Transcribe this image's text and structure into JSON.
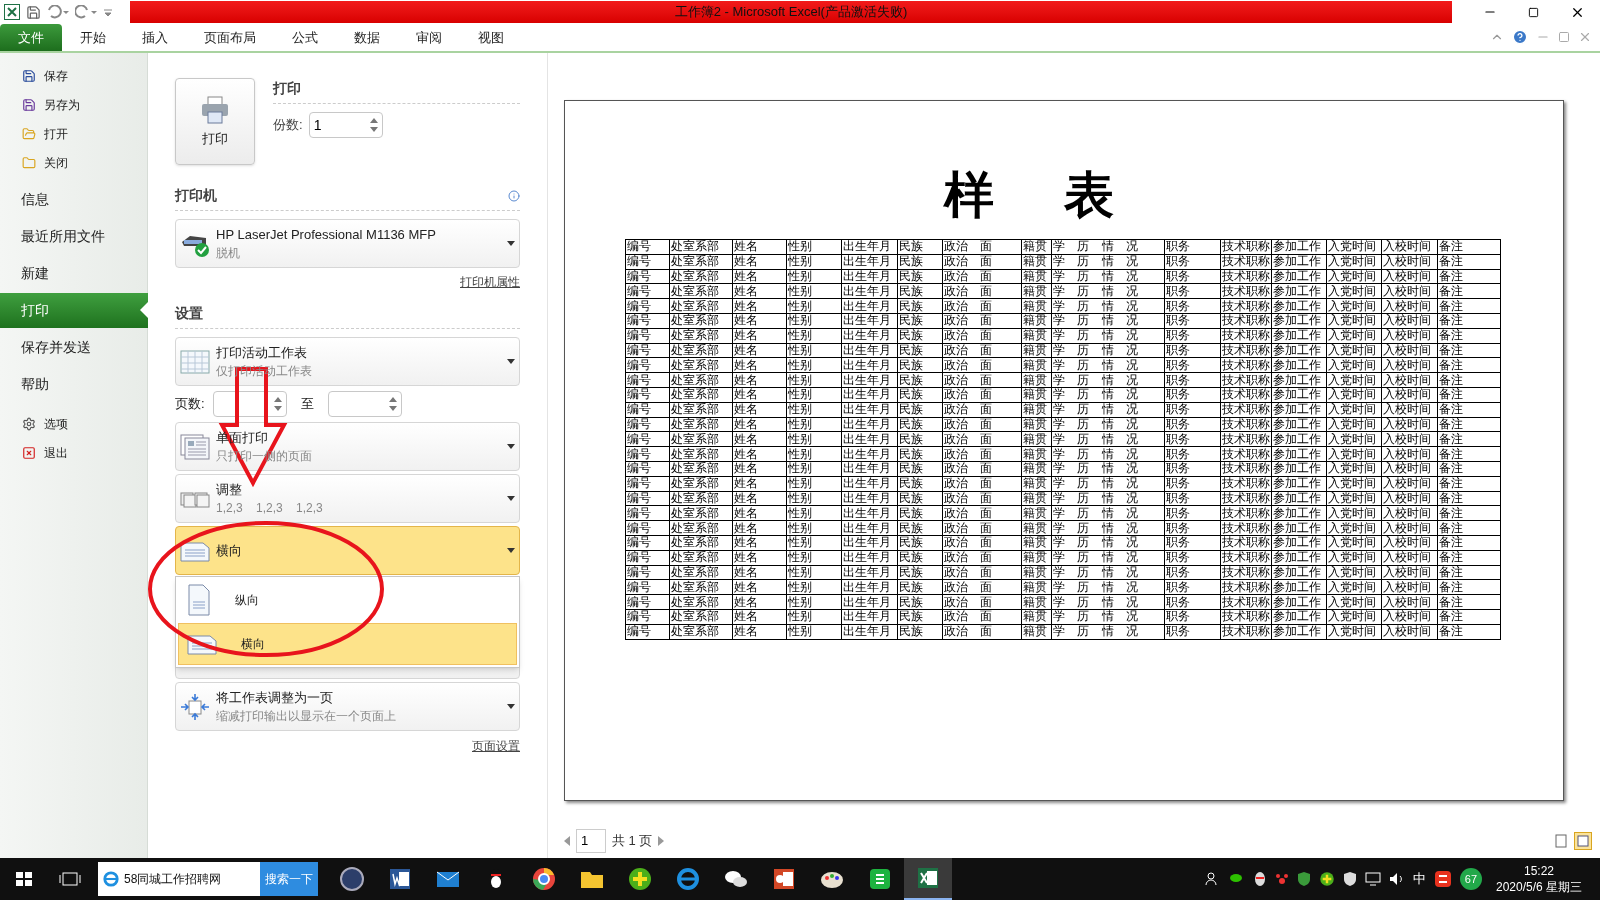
{
  "window": {
    "title": "工作簿2 - Microsoft Excel(产品激活失败)"
  },
  "ribbon_tabs": [
    {
      "label": "文件",
      "selected": true
    },
    {
      "label": "开始",
      "selected": false
    },
    {
      "label": "插入",
      "selected": false
    },
    {
      "label": "页面布局",
      "selected": false
    },
    {
      "label": "公式",
      "selected": false
    },
    {
      "label": "数据",
      "selected": false
    },
    {
      "label": "审阅",
      "selected": false
    },
    {
      "label": "视图",
      "selected": false
    }
  ],
  "backstage_nav": [
    {
      "label": "保存",
      "kind": "command",
      "selected": false
    },
    {
      "label": "另存为",
      "kind": "command",
      "selected": false
    },
    {
      "label": "打开",
      "kind": "command",
      "selected": false
    },
    {
      "label": "关闭",
      "kind": "command",
      "selected": false
    },
    {
      "label": "信息",
      "kind": "section",
      "selected": false
    },
    {
      "label": "最近所用文件",
      "kind": "section",
      "selected": false
    },
    {
      "label": "新建",
      "kind": "section",
      "selected": false
    },
    {
      "label": "打印",
      "kind": "section",
      "selected": true
    },
    {
      "label": "保存并发送",
      "kind": "section",
      "selected": false
    },
    {
      "label": "帮助",
      "kind": "section",
      "selected": false
    },
    {
      "label": "选项",
      "kind": "command",
      "selected": false
    },
    {
      "label": "退出",
      "kind": "command",
      "selected": false
    }
  ],
  "print": {
    "heading": "打印",
    "button": "打印",
    "copies_label": "份数:",
    "copies": "1"
  },
  "printer": {
    "heading": "打印机",
    "name": "HP LaserJet Professional M1136 MFP",
    "status": "脱机",
    "properties_link": "打印机属性"
  },
  "settings": {
    "heading": "设置",
    "page_setup_link": "页面设置",
    "items": [
      {
        "kind": "sheets",
        "title": "打印活动工作表",
        "subtitle": "仅打印活动工作表"
      },
      {
        "kind": "pages",
        "label": "页数:",
        "to": "至"
      },
      {
        "kind": "sides",
        "title": "单面打印",
        "subtitle": "只打印一侧的页面"
      },
      {
        "kind": "collate",
        "title": "调整",
        "subtitle": "1,2,3    1,2,3    1,2,3"
      },
      {
        "kind": "orientation",
        "title": "横向",
        "expanded": true,
        "options": [
          {
            "label": "纵向",
            "kind": "portrait",
            "selected": false
          },
          {
            "label": "横向",
            "kind": "landscape",
            "selected": true
          }
        ]
      },
      {
        "kind": "blank"
      },
      {
        "kind": "scaling",
        "title": "将工作表调整为一页",
        "subtitle": "缩减打印输出以显示在一个页面上"
      }
    ]
  },
  "preview": {
    "sheet_title": "样    表",
    "rows": [
      [
        "编号",
        "处室系部",
        "姓名",
        "性别",
        "出生年月",
        "民族",
        "政治 面",
        "籍贯",
        "学 历 情 况",
        "职务",
        "技术职称",
        "参加工作",
        "入党时间",
        "入校时间",
        "备注"
      ],
      [
        "编号",
        "处室系部",
        "姓名",
        "性别",
        "出生年月",
        "民族",
        "政治 面",
        "籍贯",
        "学 历 情 况",
        "职务",
        "技术职称",
        "参加工作",
        "入党时间",
        "入校时间",
        "备注"
      ],
      [
        "编号",
        "处室系部",
        "姓名",
        "性别",
        "出生年月",
        "民族",
        "政治 面",
        "籍贯",
        "学 历 情 况",
        "职务",
        "技术职称",
        "参加工作",
        "入党时间",
        "入校时间",
        "备注"
      ],
      [
        "编号",
        "处室系部",
        "姓名",
        "性别",
        "出生年月",
        "民族",
        "政治 面",
        "籍贯",
        "学 历 情 况",
        "职务",
        "技术职称",
        "参加工作",
        "入党时间",
        "入校时间",
        "备注"
      ],
      [
        "编号",
        "处室系部",
        "姓名",
        "性别",
        "出生年月",
        "民族",
        "政治 面",
        "籍贯",
        "学 历 情 况",
        "职务",
        "技术职称",
        "参加工作",
        "入党时间",
        "入校时间",
        "备注"
      ],
      [
        "编号",
        "处室系部",
        "姓名",
        "性别",
        "出生年月",
        "民族",
        "政治 面",
        "籍贯",
        "学 历 情 况",
        "职务",
        "技术职称",
        "参加工作",
        "入党时间",
        "入校时间",
        "备注"
      ],
      [
        "编号",
        "处室系部",
        "姓名",
        "性别",
        "出生年月",
        "民族",
        "政治 面",
        "籍贯",
        "学 历 情 况",
        "职务",
        "技术职称",
        "参加工作",
        "入党时间",
        "入校时间",
        "备注"
      ],
      [
        "编号",
        "处室系部",
        "姓名",
        "性别",
        "出生年月",
        "民族",
        "政治 面",
        "籍贯",
        "学 历 情 况",
        "职务",
        "技术职称",
        "参加工作",
        "入党时间",
        "入校时间",
        "备注"
      ],
      [
        "编号",
        "处室系部",
        "姓名",
        "性别",
        "出生年月",
        "民族",
        "政治 面",
        "籍贯",
        "学 历 情 况",
        "职务",
        "技术职称",
        "参加工作",
        "入党时间",
        "入校时间",
        "备注"
      ],
      [
        "编号",
        "处室系部",
        "姓名",
        "性别",
        "出生年月",
        "民族",
        "政治 面",
        "籍贯",
        "学 历 情 况",
        "职务",
        "技术职称",
        "参加工作",
        "入党时间",
        "入校时间",
        "备注"
      ],
      [
        "编号",
        "处室系部",
        "姓名",
        "性别",
        "出生年月",
        "民族",
        "政治 面",
        "籍贯",
        "学 历 情 况",
        "职务",
        "技术职称",
        "参加工作",
        "入党时间",
        "入校时间",
        "备注"
      ],
      [
        "编号",
        "处室系部",
        "姓名",
        "性别",
        "出生年月",
        "民族",
        "政治 面",
        "籍贯",
        "学 历 情 况",
        "职务",
        "技术职称",
        "参加工作",
        "入党时间",
        "入校时间",
        "备注"
      ],
      [
        "编号",
        "处室系部",
        "姓名",
        "性别",
        "出生年月",
        "民族",
        "政治 面",
        "籍贯",
        "学 历 情 况",
        "职务",
        "技术职称",
        "参加工作",
        "入党时间",
        "入校时间",
        "备注"
      ],
      [
        "编号",
        "处室系部",
        "姓名",
        "性别",
        "出生年月",
        "民族",
        "政治 面",
        "籍贯",
        "学 历 情 况",
        "职务",
        "技术职称",
        "参加工作",
        "入党时间",
        "入校时间",
        "备注"
      ],
      [
        "编号",
        "处室系部",
        "姓名",
        "性别",
        "出生年月",
        "民族",
        "政治 面",
        "籍贯",
        "学 历 情 况",
        "职务",
        "技术职称",
        "参加工作",
        "入党时间",
        "入校时间",
        "备注"
      ],
      [
        "编号",
        "处室系部",
        "姓名",
        "性别",
        "出生年月",
        "民族",
        "政治 面",
        "籍贯",
        "学 历 情 况",
        "职务",
        "技术职称",
        "参加工作",
        "入党时间",
        "入校时间",
        "备注"
      ],
      [
        "编号",
        "处室系部",
        "姓名",
        "性别",
        "出生年月",
        "民族",
        "政治 面",
        "籍贯",
        "学 历 情 况",
        "职务",
        "技术职称",
        "参加工作",
        "入党时间",
        "入校时间",
        "备注"
      ],
      [
        "编号",
        "处室系部",
        "姓名",
        "性别",
        "出生年月",
        "民族",
        "政治 面",
        "籍贯",
        "学 历 情 况",
        "职务",
        "技术职称",
        "参加工作",
        "入党时间",
        "入校时间",
        "备注"
      ],
      [
        "编号",
        "处室系部",
        "姓名",
        "性别",
        "出生年月",
        "民族",
        "政治 面",
        "籍贯",
        "学 历 情 况",
        "职务",
        "技术职称",
        "参加工作",
        "入党时间",
        "入校时间",
        "备注"
      ],
      [
        "编号",
        "处室系部",
        "姓名",
        "性别",
        "出生年月",
        "民族",
        "政治 面",
        "籍贯",
        "学 历 情 况",
        "职务",
        "技术职称",
        "参加工作",
        "入党时间",
        "入校时间",
        "备注"
      ],
      [
        "编号",
        "处室系部",
        "姓名",
        "性别",
        "出生年月",
        "民族",
        "政治 面",
        "籍贯",
        "学 历 情 况",
        "职务",
        "技术职称",
        "参加工作",
        "入党时间",
        "入校时间",
        "备注"
      ],
      [
        "编号",
        "处室系部",
        "姓名",
        "性别",
        "出生年月",
        "民族",
        "政治 面",
        "籍贯",
        "学 历 情 况",
        "职务",
        "技术职称",
        "参加工作",
        "入党时间",
        "入校时间",
        "备注"
      ],
      [
        "编号",
        "处室系部",
        "姓名",
        "性别",
        "出生年月",
        "民族",
        "政治 面",
        "籍贯",
        "学 历 情 况",
        "职务",
        "技术职称",
        "参加工作",
        "入党时间",
        "入校时间",
        "备注"
      ],
      [
        "编号",
        "处室系部",
        "姓名",
        "性别",
        "出生年月",
        "民族",
        "政治 面",
        "籍贯",
        "学 历 情 况",
        "职务",
        "技术职称",
        "参加工作",
        "入党时间",
        "入校时间",
        "备注"
      ],
      [
        "编号",
        "处室系部",
        "姓名",
        "性别",
        "出生年月",
        "民族",
        "政治 面",
        "籍贯",
        "学 历 情 况",
        "职务",
        "技术职称",
        "参加工作",
        "入党时间",
        "入校时间",
        "备注"
      ],
      [
        "编号",
        "处室系部",
        "姓名",
        "性别",
        "出生年月",
        "民族",
        "政治 面",
        "籍贯",
        "学 历 情 况",
        "职务",
        "技术职称",
        "参加工作",
        "入党时间",
        "入校时间",
        "备注"
      ],
      [
        "编号",
        "处室系部",
        "姓名",
        "性别",
        "出生年月",
        "民族",
        "政治 面",
        "籍贯",
        "学 历 情 况",
        "职务",
        "技术职称",
        "参加工作",
        "入党时间",
        "入校时间",
        "备注"
      ]
    ],
    "current_page": "1",
    "page_total": "共 1 页"
  },
  "taskbar": {
    "search_value": "58同城工作招聘网",
    "search_button": "搜索一下",
    "apps": [
      {
        "kind": "zb",
        "active": false
      },
      {
        "kind": "word",
        "active": false
      },
      {
        "kind": "mail",
        "active": false
      },
      {
        "kind": "qq",
        "active": false
      },
      {
        "kind": "browser",
        "active": false
      },
      {
        "kind": "folder",
        "active": false
      },
      {
        "kind": "plus",
        "active": false
      },
      {
        "kind": "ie",
        "active": false
      },
      {
        "kind": "wechat",
        "active": false
      },
      {
        "kind": "ppt",
        "active": false
      },
      {
        "kind": "paint",
        "active": false
      },
      {
        "kind": "sheets",
        "active": false
      },
      {
        "kind": "excel",
        "active": true
      }
    ],
    "ime": "中",
    "badge": "67",
    "time": "15:22",
    "date": "2020/5/6 星期三"
  }
}
